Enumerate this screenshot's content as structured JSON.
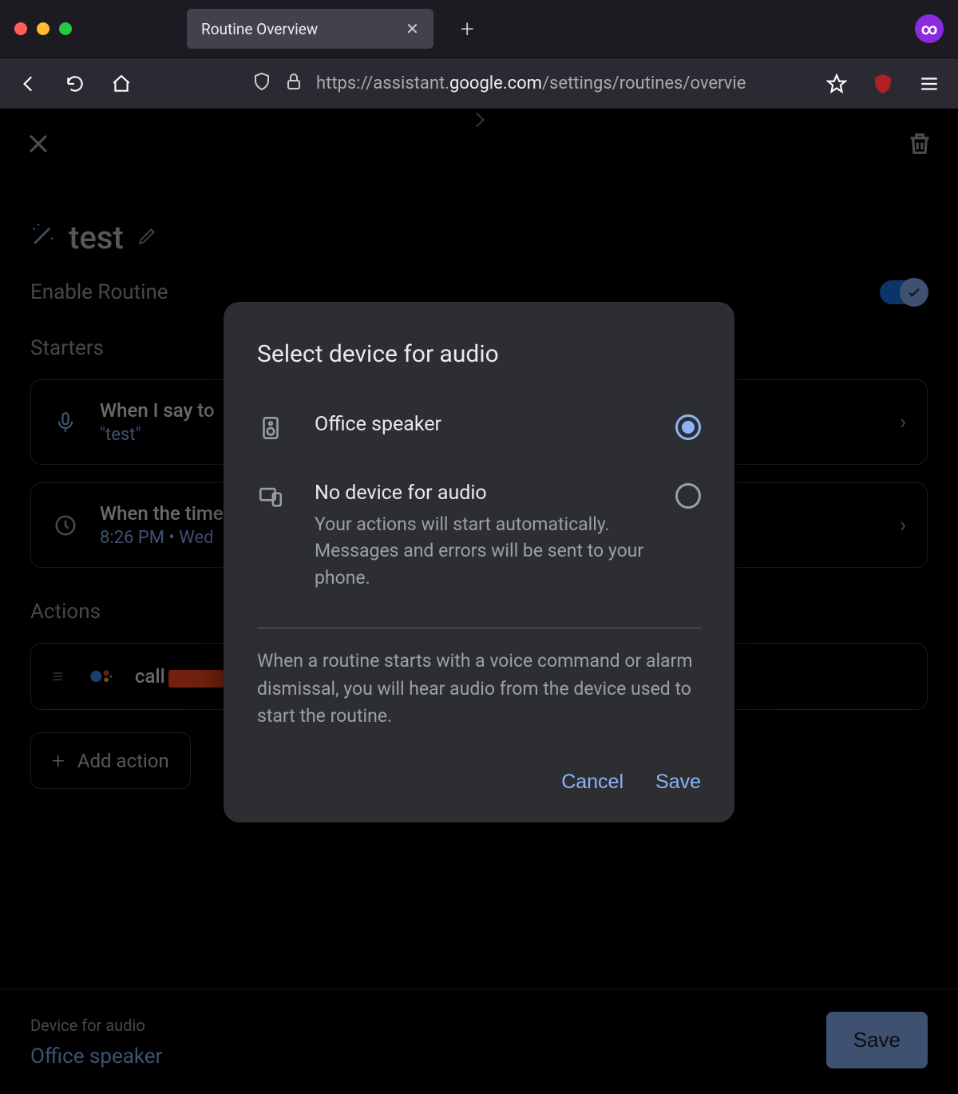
{
  "browser": {
    "tab_title": "Routine Overview",
    "url_prefix": "https://assistant.",
    "url_host": "google.com",
    "url_path": "/settings/routines/overvie"
  },
  "page": {
    "routine_name": "test",
    "enable_label": "Enable Routine",
    "toggle_on": true,
    "starters_heading": "Starters",
    "starter1_line1": "When I say to ",
    "starter1_line2": "\"test\"",
    "starter2_line1": "When the time",
    "starter2_line2": "8:26 PM • Wed",
    "actions_heading": "Actions",
    "action1_text": "call",
    "add_action_label": "Add action"
  },
  "footer": {
    "device_label": "Device for audio",
    "device_value": "Office speaker",
    "save_label": "Save"
  },
  "modal": {
    "title": "Select device for audio",
    "option1_label": "Office speaker",
    "option1_selected": true,
    "option2_label": "No device for audio",
    "option2_desc": "Your actions will start automatically. Messages and errors will be sent to your phone.",
    "option2_selected": false,
    "note": "When a routine starts with a voice command or alarm dismissal, you will hear audio from the device used to start the routine.",
    "cancel_label": "Cancel",
    "save_label": "Save"
  }
}
